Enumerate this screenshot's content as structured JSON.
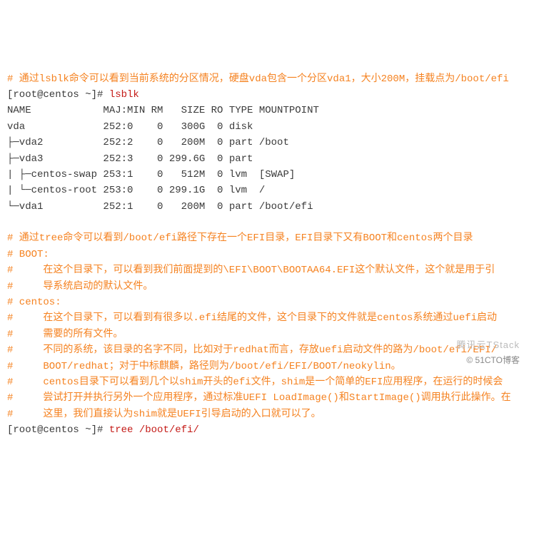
{
  "comment1": "# 通过lsblk命令可以看到当前系统的分区情况，硬盘vda包含一个分区vda1，大小200M，挂载点为/boot/efi",
  "prompt1": "[root@centos ~]# ",
  "cmd1": "lsblk",
  "header": "NAME            MAJ:MIN RM   SIZE RO TYPE MOUNTPOINT",
  "r1": "vda             252:0    0   300G  0 disk",
  "r2": "├─vda2          252:2    0   200M  0 part /boot",
  "r3": "├─vda3          252:3    0 299.6G  0 part",
  "r4": "| ├─centos-swap 253:1    0   512M  0 lvm  [SWAP]",
  "r5": "| └─centos-root 253:0    0 299.1G  0 lvm  /",
  "r6": "└─vda1          252:1    0   200M  0 part /boot/efi",
  "c2": "# 通过tree命令可以看到/boot/efi路径下存在一个EFI目录，EFI目录下又有BOOT和centos两个目录",
  "c3": "# BOOT:",
  "c4": "#     在这个目录下，可以看到我们前面提到的\\EFI\\BOOT\\BOOTAA64.EFI这个默认文件，这个就是用于引",
  "c5": "#     导系统启动的默认文件。",
  "c6": "# centos:",
  "c7": "#     在这个目录下，可以看到有很多以.efi结尾的文件，这个目录下的文件就是centos系统通过uefi启动",
  "c8": "#     需要的所有文件。",
  "c9": "#     不同的系统，该目录的名字不同，比如对于redhat而言，存放uefi启动文件的路为/boot/efi/EFI/",
  "c10": "#     BOOT/redhat；对于中标麒麟，路径则为/boot/efi/EFI/BOOT/neokylin。",
  "c11": "#     centos目录下可以看到几个以shim开头的efi文件，shim是一个简单的EFI应用程序，在运行的时候会",
  "c12": "#     尝试打开并执行另外一个应用程序，通过标准UEFI LoadImage()和StartImage()调用执行此操作。在",
  "c13": "#     这里，我们直接认为shim就是UEFI引导启动的入口就可以了。",
  "prompt2": "[root@centos ~]# ",
  "cmd2": "tree /boot/efi/",
  "watermark": "腾讯云TStack",
  "brand": "© 51CTO博客"
}
